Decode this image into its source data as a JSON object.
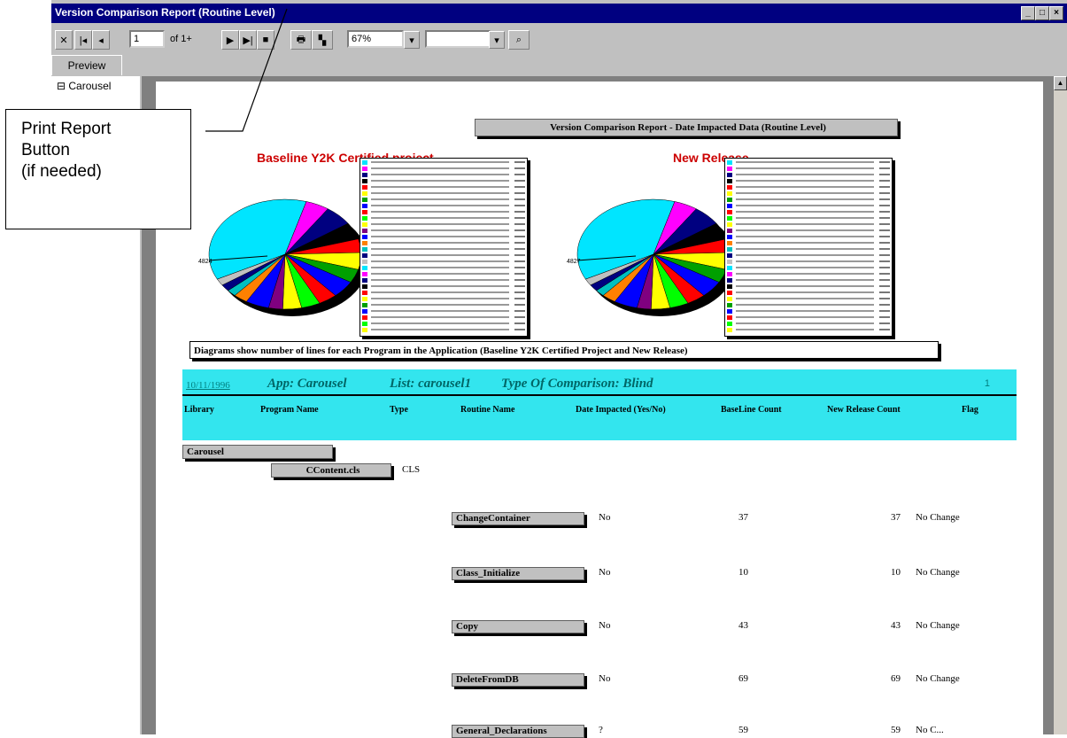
{
  "window": {
    "title": "Version Comparison Report (Routine Level)",
    "controls": [
      "_",
      "□",
      "×"
    ]
  },
  "toolbar": {
    "page_value": "1",
    "page_of": "of 1+",
    "zoom": "67%",
    "search_value": ""
  },
  "tab": {
    "label": "Preview"
  },
  "tree": {
    "root": "Carousel"
  },
  "report": {
    "title": "Version Comparison Report - Date Impacted Data (Routine Level)",
    "chart_left_title": "Baseline Y2K Certified project",
    "chart_right_title": "New Release",
    "chart_left_big_label": "4824",
    "chart_right_big_label": "4827",
    "caption": "Diagrams show number of lines for each Program in the Application (Baseline Y2K Certified Project and New Release)",
    "band": {
      "date": "10/11/1996",
      "app_label": "App: Carousel",
      "list_label": "List: carousel1",
      "type_label": "Type Of Comparison: Blind",
      "page": "1"
    },
    "columns": [
      "Library",
      "Program Name",
      "Type",
      "Routine Name",
      "Date Impacted (Yes/No)",
      "BaseLine Count",
      "New Release Count",
      "Flag"
    ],
    "library": "Carousel",
    "program": "CContent.cls",
    "program_type": "CLS",
    "rows": [
      {
        "routine": "ChangeContainer",
        "impacted": "No",
        "baseline": "37",
        "newrel": "37",
        "flag": "No Change"
      },
      {
        "routine": "Class_Initialize",
        "impacted": "No",
        "baseline": "10",
        "newrel": "10",
        "flag": "No Change"
      },
      {
        "routine": "Copy",
        "impacted": "No",
        "baseline": "43",
        "newrel": "43",
        "flag": "No Change"
      },
      {
        "routine": "DeleteFromDB",
        "impacted": "No",
        "baseline": "69",
        "newrel": "69",
        "flag": "No Change"
      },
      {
        "routine": "General_Declarations",
        "impacted": "?",
        "baseline": "59",
        "newrel": "59",
        "flag": "No C..."
      }
    ]
  },
  "callout": {
    "line1": "Print Report",
    "line2": "Button",
    "line3": "(if needed)"
  },
  "colors": {
    "titlebar": "#000080",
    "band": "#33e5ee",
    "chart_title": "#cc0000"
  }
}
